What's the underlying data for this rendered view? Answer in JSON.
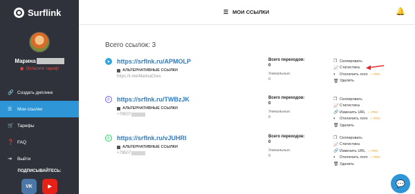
{
  "app": {
    "logo_text": "Surflink",
    "logo_icon": "surflink-logo-icon"
  },
  "user": {
    "name": "Марина",
    "pay_link": "Оплатите тариф!",
    "pay_icon": "card-icon"
  },
  "menu": [
    {
      "label": "Создать диплинк",
      "icon": "link-icon",
      "active": false
    },
    {
      "label": "Мои ссылки",
      "icon": "list-icon",
      "active": true
    },
    {
      "label": "Тарифы",
      "icon": "cart-icon",
      "active": false
    },
    {
      "label": "FAQ",
      "icon": "question-icon",
      "active": false
    },
    {
      "label": "Выйти",
      "icon": "logout-icon",
      "active": false
    }
  ],
  "subscribe": {
    "label": "ПОДПИСЫВАЙТЕСЬ:",
    "vk": "VK",
    "youtube": "▶"
  },
  "header": {
    "title": "МОИ ССЫЛКИ",
    "title_icon": "list-icon",
    "bell_icon": "bell-icon"
  },
  "total_links": "Всего ссылок: 3",
  "stats_labels": {
    "total": "Всего переходов:",
    "unique": "Уникальных:"
  },
  "action_labels": {
    "copy": "Скопировать",
    "stats": "Статистика",
    "change_url": "Изменить URL",
    "disable_logo": "Отключить лого",
    "delete": "Удалить",
    "pro": "PRO"
  },
  "alt_links_label": "АЛЬТЕРНАТИВНЫЕ ССЫЛКИ",
  "links": [
    {
      "network": "telegram",
      "network_icon": "telegram-icon",
      "short_url": "https://srflnk.ru/APMOLP",
      "original": "https://t.me/MarinaChes",
      "total_clicks": "0",
      "unique_clicks": "0",
      "has_change_url": false
    },
    {
      "network": "viber",
      "network_icon": "viber-icon",
      "short_url": "https://srflnk.ru/TWBzJK",
      "original": "+79507",
      "total_clicks": "0",
      "unique_clicks": "0",
      "has_change_url": true
    },
    {
      "network": "whatsapp",
      "network_icon": "whatsapp-icon",
      "short_url": "https://srflnk.ru/vJUHRl",
      "original": "+79507",
      "total_clicks": "0",
      "unique_clicks": "0",
      "has_change_url": true
    }
  ],
  "colors": {
    "sidebar": "#2f323b",
    "accent": "#2e96d6",
    "pro": "#f39c12",
    "alert": "#e74c3c"
  }
}
